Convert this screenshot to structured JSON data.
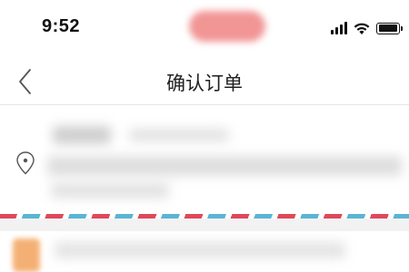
{
  "status_bar": {
    "time": "9:52",
    "icons": [
      "signal-icon",
      "wifi-icon",
      "battery-icon"
    ],
    "pill_color": "#f08a8a"
  },
  "nav": {
    "back_icon": "chevron-left-icon",
    "title": "确认订单"
  },
  "address": {
    "icon": "location-pin-icon",
    "content_blurred": true
  },
  "colors": {
    "airmail_red": "#e0485a",
    "airmail_blue": "#5ab4d4",
    "shop_icon": "#f3a35c"
  }
}
